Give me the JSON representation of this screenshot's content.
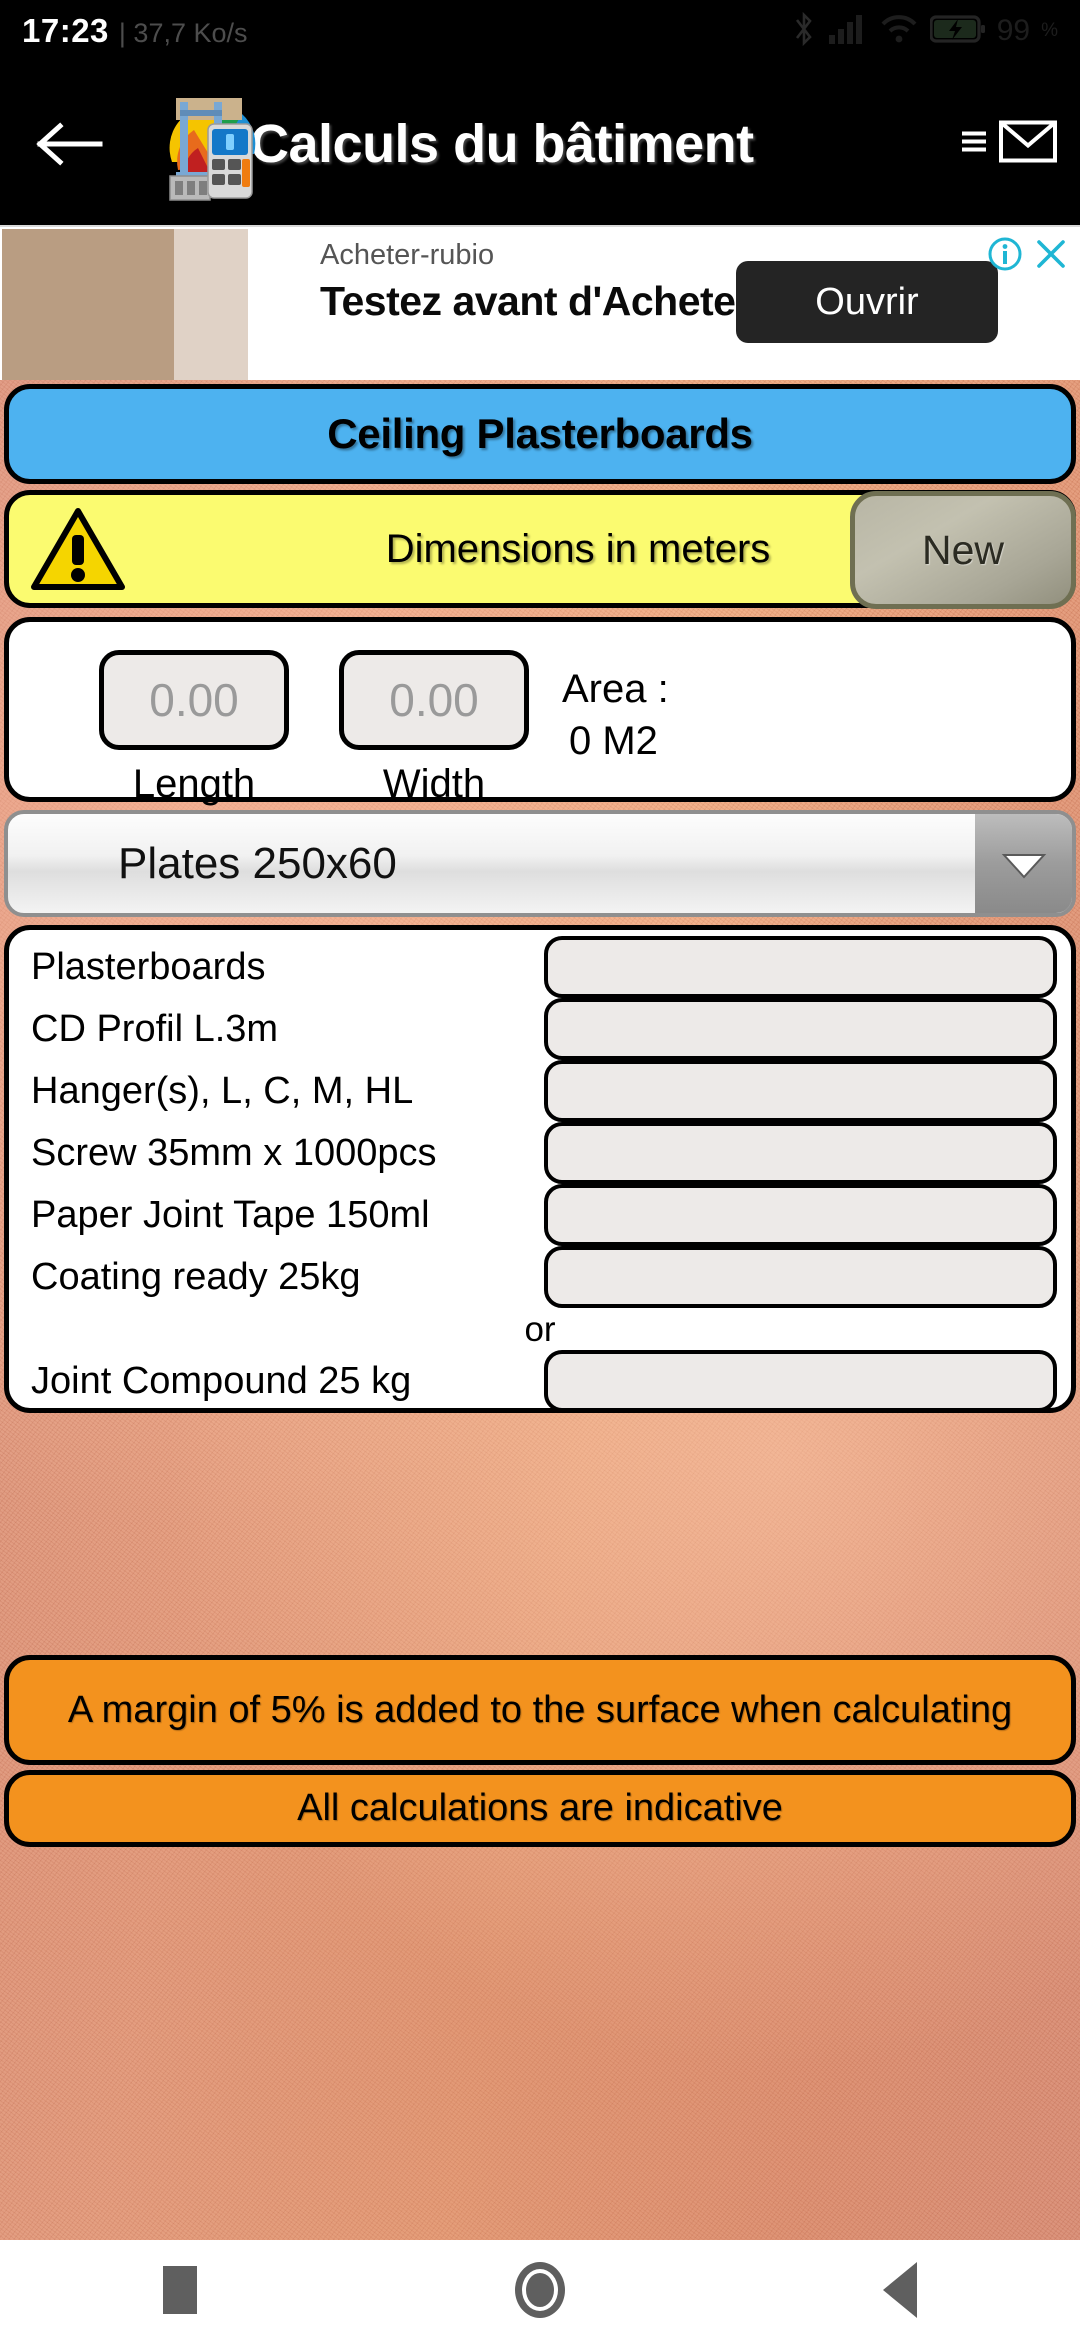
{
  "statusbar": {
    "time": "17:23",
    "network_speed": "| 37,7 Ko/s",
    "battery_percent": "99",
    "percent_symbol": "%",
    "icons": [
      "bluetooth-icon",
      "signal-icon",
      "wifi-icon",
      "battery-charging-icon"
    ]
  },
  "appbar": {
    "back_icon": "back-arrow-icon",
    "logo_icon": "app-logo-icon",
    "title": "Calculs du bâtiment",
    "menu_icon": "menu-lines-icon",
    "mail_icon": "envelope-icon"
  },
  "ad": {
    "advertiser": "Acheter-rubio",
    "headline": "Testez avant d'Acheter",
    "cta_label": "Ouvrir",
    "info_icon": "ad-info-icon",
    "close_icon": "ad-close-icon",
    "accent_color": "#1fb6d4"
  },
  "page": {
    "title": "Ceiling Plasterboards",
    "title_bg": "#4db2f0",
    "warning": {
      "icon": "warning-triangle-icon",
      "text": "Dimensions in meters",
      "bg": "#fbfb70",
      "new_button_label": "New"
    }
  },
  "dimensions": {
    "length": {
      "value": "0.00",
      "placeholder": "0.00",
      "label": "Length"
    },
    "width": {
      "value": "0.00",
      "placeholder": "0.00",
      "label": "Width"
    },
    "area_label": "Area :",
    "area_value": "0 M2"
  },
  "plate_select": {
    "selected": "Plates 250x60",
    "arrow_icon": "chevron-down-icon"
  },
  "materials": [
    {
      "label": "Plasterboards",
      "value": ""
    },
    {
      "label": "CD Profil L.3m",
      "value": ""
    },
    {
      "label": "Hanger(s), L, C, M, HL",
      "value": ""
    },
    {
      "label": "Screw 35mm x 1000pcs",
      "value": ""
    },
    {
      "label": "Paper Joint Tape 150ml",
      "value": ""
    },
    {
      "label": "Coating ready 25kg",
      "value": ""
    },
    {
      "label": "Joint Compound 25 kg",
      "value": ""
    }
  ],
  "materials_separator": "or",
  "notices": [
    {
      "text": "A margin of 5% is added to the surface when calculating"
    },
    {
      "text": "All calculations are indicative"
    }
  ],
  "notice_color": "#f3921e",
  "navbar": {
    "recents_icon": "recents-square-icon",
    "home_icon": "home-circle-icon",
    "back_icon": "back-triangle-icon"
  }
}
